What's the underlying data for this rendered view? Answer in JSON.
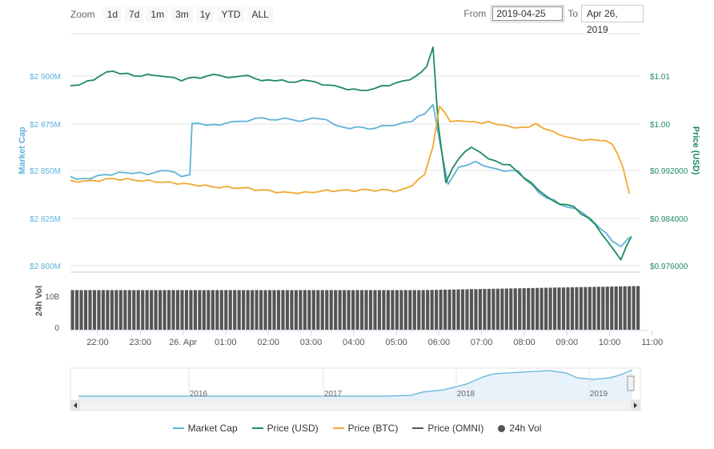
{
  "toolbar": {
    "zoom_label": "Zoom",
    "buttons": [
      "1d",
      "7d",
      "1m",
      "3m",
      "1y",
      "YTD",
      "ALL"
    ]
  },
  "range": {
    "from_label": "From",
    "from_value": "2019-04-25",
    "to_label": "To",
    "to_value": "Apr 26, 2019"
  },
  "colors": {
    "market_cap": "#5fb2d8",
    "price_usd": "#1f8a5e",
    "price_btc": "#f0a830",
    "price_omni": "#555555",
    "volume": "#555555"
  },
  "chart_data": {
    "type": "line",
    "xlabel": "",
    "x_ticks": [
      "22:00",
      "23:00",
      "26. Apr",
      "01:00",
      "02:00",
      "03:00",
      "04:00",
      "05:00",
      "06:00",
      "07:00",
      "08:00",
      "09:00",
      "10:00",
      "11:00"
    ],
    "x_range": [
      "2019-04-25 21:25",
      "2019-04-26 10:50"
    ],
    "y_left": {
      "label": "Market Cap",
      "ticks": [
        "$2 800M",
        "$2 825M",
        "$2 850M",
        "$2 875M",
        "$2 900M"
      ],
      "range": [
        2800,
        2900
      ]
    },
    "y_right": {
      "label": "Price (USD)",
      "ticks": [
        "$0.976000",
        "$0.984000",
        "$0.992000",
        "$1.00",
        "$1.01"
      ]
    },
    "volume_axis": {
      "label": "24h Vol",
      "ticks": [
        "0",
        "10B"
      ]
    },
    "series": [
      {
        "name": "Market Cap",
        "axis": "left",
        "points": [
          [
            0,
            2847
          ],
          [
            0.3,
            2846
          ],
          [
            0.8,
            2848
          ],
          [
            1.3,
            2849
          ],
          [
            1.8,
            2848
          ],
          [
            2.3,
            2850
          ],
          [
            2.6,
            2847
          ],
          [
            2.8,
            2848
          ],
          [
            2.85,
            2875
          ],
          [
            3.2,
            2874
          ],
          [
            3.8,
            2876
          ],
          [
            4.5,
            2878
          ],
          [
            5.2,
            2877
          ],
          [
            6,
            2877
          ],
          [
            6.4,
            2873
          ],
          [
            7,
            2872
          ],
          [
            7.6,
            2874
          ],
          [
            8.0,
            2876
          ],
          [
            8.3,
            2880
          ],
          [
            8.5,
            2885
          ],
          [
            8.7,
            2860
          ],
          [
            8.85,
            2843
          ],
          [
            9.1,
            2852
          ],
          [
            9.5,
            2855
          ],
          [
            10,
            2851
          ],
          [
            10.5,
            2850
          ],
          [
            11,
            2838
          ],
          [
            11.5,
            2832
          ],
          [
            12,
            2828
          ],
          [
            12.4,
            2820
          ],
          [
            12.7,
            2813
          ],
          [
            12.9,
            2810
          ],
          [
            13.1,
            2815
          ]
        ]
      },
      {
        "name": "Price (USD)",
        "axis": "right",
        "points": [
          [
            0,
            1.008
          ],
          [
            0.4,
            1.009
          ],
          [
            1.0,
            1.011
          ],
          [
            1.5,
            1.01
          ],
          [
            2.1,
            1.01
          ],
          [
            2.6,
            1.009
          ],
          [
            3.2,
            1.01
          ],
          [
            4.0,
            1.01
          ],
          [
            4.8,
            1.009
          ],
          [
            5.6,
            1.009
          ],
          [
            6.2,
            1.008
          ],
          [
            6.8,
            1.007
          ],
          [
            7.3,
            1.008
          ],
          [
            7.8,
            1.009
          ],
          [
            8.1,
            1.01
          ],
          [
            8.35,
            1.012
          ],
          [
            8.5,
            1.016
          ],
          [
            8.62,
            1.0
          ],
          [
            8.8,
            0.99
          ],
          [
            9.1,
            0.994
          ],
          [
            9.4,
            0.996
          ],
          [
            9.8,
            0.994
          ],
          [
            10.3,
            0.993
          ],
          [
            10.8,
            0.99
          ],
          [
            11.3,
            0.987
          ],
          [
            11.8,
            0.986
          ],
          [
            12.3,
            0.983
          ],
          [
            12.6,
            0.98
          ],
          [
            12.9,
            0.977
          ],
          [
            13.15,
            0.981
          ]
        ]
      },
      {
        "name": "Price (BTC)",
        "axis": "right",
        "points": [
          [
            0,
            2845
          ],
          [
            0.5,
            2845
          ],
          [
            1.0,
            2846
          ],
          [
            1.5,
            2845
          ],
          [
            2.0,
            2844
          ],
          [
            2.5,
            2843
          ],
          [
            3.0,
            2842
          ],
          [
            3.5,
            2841
          ],
          [
            4.0,
            2841
          ],
          [
            4.5,
            2840
          ],
          [
            5.0,
            2839
          ],
          [
            5.5,
            2839
          ],
          [
            6.0,
            2840
          ],
          [
            6.5,
            2840
          ],
          [
            7.0,
            2840
          ],
          [
            7.6,
            2839
          ],
          [
            8.0,
            2842
          ],
          [
            8.3,
            2848
          ],
          [
            8.5,
            2863
          ],
          [
            8.65,
            2884
          ],
          [
            8.9,
            2876
          ],
          [
            9.3,
            2876
          ],
          [
            9.8,
            2876
          ],
          [
            10.2,
            2874
          ],
          [
            10.6,
            2873
          ],
          [
            10.9,
            2875
          ],
          [
            11.3,
            2871
          ],
          [
            11.6,
            2868
          ],
          [
            12.0,
            2866
          ],
          [
            12.4,
            2866
          ],
          [
            12.7,
            2864
          ],
          [
            12.95,
            2852
          ],
          [
            13.1,
            2838
          ]
        ]
      },
      {
        "name": "Price (OMNI)",
        "axis": "right",
        "points": []
      }
    ],
    "bars": {
      "name": "24h Vol",
      "start": 11.8,
      "end": 13.0,
      "count": 130
    },
    "navigator": {
      "years": [
        "2016",
        "2017",
        "2018",
        "2019"
      ]
    },
    "legend": [
      "Market Cap",
      "Price (USD)",
      "Price (BTC)",
      "Price (OMNI)",
      "24h Vol"
    ],
    "legend_position": "bottom-center",
    "grid": true
  }
}
